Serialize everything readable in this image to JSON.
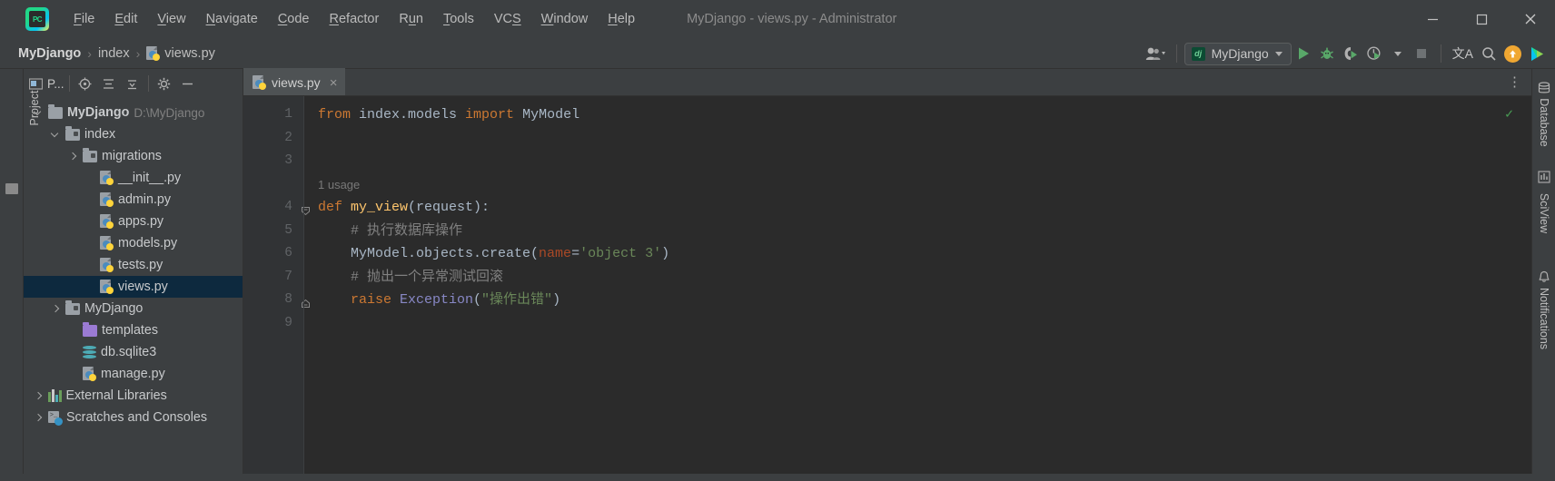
{
  "window": {
    "title": "MyDjango - views.py - Administrator",
    "logo_text": "PC",
    "minimize": "minimize-icon",
    "maximize": "maximize-icon",
    "close": "close-icon"
  },
  "menubar": {
    "items": [
      {
        "label": "File",
        "mnemonic": "F"
      },
      {
        "label": "Edit",
        "mnemonic": "E"
      },
      {
        "label": "View",
        "mnemonic": "V"
      },
      {
        "label": "Navigate",
        "mnemonic": "N"
      },
      {
        "label": "Code",
        "mnemonic": "C"
      },
      {
        "label": "Refactor",
        "mnemonic": "R"
      },
      {
        "label": "Run",
        "mnemonic": "u"
      },
      {
        "label": "Tools",
        "mnemonic": "T"
      },
      {
        "label": "VCS",
        "mnemonic": "S"
      },
      {
        "label": "Window",
        "mnemonic": "W"
      },
      {
        "label": "Help",
        "mnemonic": "H"
      }
    ]
  },
  "breadcrumb": {
    "project": "MyDjango",
    "folder": "index",
    "file": "views.py",
    "separator": "›"
  },
  "toolbar": {
    "account_icon": "user-account-icon",
    "run_config": "MyDjango",
    "run_config_icon": "dj",
    "run": "run-icon",
    "debug": "debug-icon",
    "coverage": "run-with-coverage-icon",
    "profile": "profiler-icon",
    "stop": "stop-icon",
    "translate": "文A",
    "search": "search-icon",
    "update": "update-icon",
    "ide_play": "ide-play-icon"
  },
  "left_rail": {
    "label": "Project"
  },
  "project_panel": {
    "title": "P...",
    "buttons": [
      "locate-icon",
      "collapse-all-icon",
      "expand-icon",
      "settings-gear-icon",
      "hide-icon"
    ],
    "tree": [
      {
        "label": "MyDjango",
        "path": "D:\\MyDjango",
        "icon": "folder",
        "arrow": "down",
        "indent": 0,
        "bold": true,
        "selected": false
      },
      {
        "label": "index",
        "path": "",
        "icon": "folder-module",
        "arrow": "down",
        "indent": 1,
        "bold": false,
        "selected": false
      },
      {
        "label": "migrations",
        "path": "",
        "icon": "folder-module",
        "arrow": "right",
        "indent": 2,
        "bold": false,
        "selected": false
      },
      {
        "label": "__init__.py",
        "path": "",
        "icon": "python",
        "arrow": "none",
        "indent": 3,
        "bold": false,
        "selected": false
      },
      {
        "label": "admin.py",
        "path": "",
        "icon": "python",
        "arrow": "none",
        "indent": 3,
        "bold": false,
        "selected": false
      },
      {
        "label": "apps.py",
        "path": "",
        "icon": "python",
        "arrow": "none",
        "indent": 3,
        "bold": false,
        "selected": false
      },
      {
        "label": "models.py",
        "path": "",
        "icon": "python",
        "arrow": "none",
        "indent": 3,
        "bold": false,
        "selected": false
      },
      {
        "label": "tests.py",
        "path": "",
        "icon": "python",
        "arrow": "none",
        "indent": 3,
        "bold": false,
        "selected": false
      },
      {
        "label": "views.py",
        "path": "",
        "icon": "python",
        "arrow": "none",
        "indent": 3,
        "bold": false,
        "selected": true
      },
      {
        "label": "MyDjango",
        "path": "",
        "icon": "folder-module",
        "arrow": "right",
        "indent": 1,
        "bold": false,
        "selected": false
      },
      {
        "label": "templates",
        "path": "",
        "icon": "folder-purple",
        "arrow": "none",
        "indent": 2,
        "bold": false,
        "selected": false
      },
      {
        "label": "db.sqlite3",
        "path": "",
        "icon": "database",
        "arrow": "none",
        "indent": 2,
        "bold": false,
        "selected": false
      },
      {
        "label": "manage.py",
        "path": "",
        "icon": "python",
        "arrow": "none",
        "indent": 2,
        "bold": false,
        "selected": false
      },
      {
        "label": "External Libraries",
        "path": "",
        "icon": "libraries",
        "arrow": "right",
        "indent": 0,
        "bold": false,
        "selected": false
      },
      {
        "label": "Scratches and Consoles",
        "path": "",
        "icon": "scratches",
        "arrow": "right",
        "indent": 0,
        "bold": false,
        "selected": false
      }
    ]
  },
  "editor": {
    "tab": {
      "label": "views.py",
      "icon": "python",
      "close": "×"
    },
    "more_actions": "⋮",
    "inspection_status": "✓",
    "line_numbers": [
      "1",
      "2",
      "3",
      "4",
      "5",
      "6",
      "7",
      "8",
      "9"
    ],
    "usage_hint": "1 usage",
    "code": {
      "l1_from": "from",
      "l1_module": " index.models ",
      "l1_import": "import",
      "l1_name": " MyModel",
      "l4_def": "def",
      "l4_fn": " my_view",
      "l4_args": "(request):",
      "l5_comment": "    # 执行数据库操作",
      "l6_obj": "    MyModel.objects.create(",
      "l6_kwarg": "name",
      "l6_eq": "=",
      "l6_str": "'object 3'",
      "l6_close": ")",
      "l7_comment": "    # 抛出一个异常测试回滚",
      "l8_raise": "    raise",
      "l8_exc": " Exception",
      "l8_open": "(",
      "l8_str": "\"操作出错\"",
      "l8_close": ")"
    }
  },
  "right_rail": {
    "items": [
      {
        "label": "Database",
        "icon": "database-icon"
      },
      {
        "label": "SciView",
        "icon": "sciview-icon"
      },
      {
        "label": "Notifications",
        "icon": "notifications-icon"
      }
    ]
  },
  "colors": {
    "keyword": "#cc7832",
    "function": "#ffc66d",
    "string": "#6a8759",
    "comment": "#808080",
    "kwarg": "#aa4926",
    "exception": "#8888c6",
    "selection": "#0d293e",
    "accent_green": "#499c54",
    "accent_orange": "#f0a732"
  }
}
